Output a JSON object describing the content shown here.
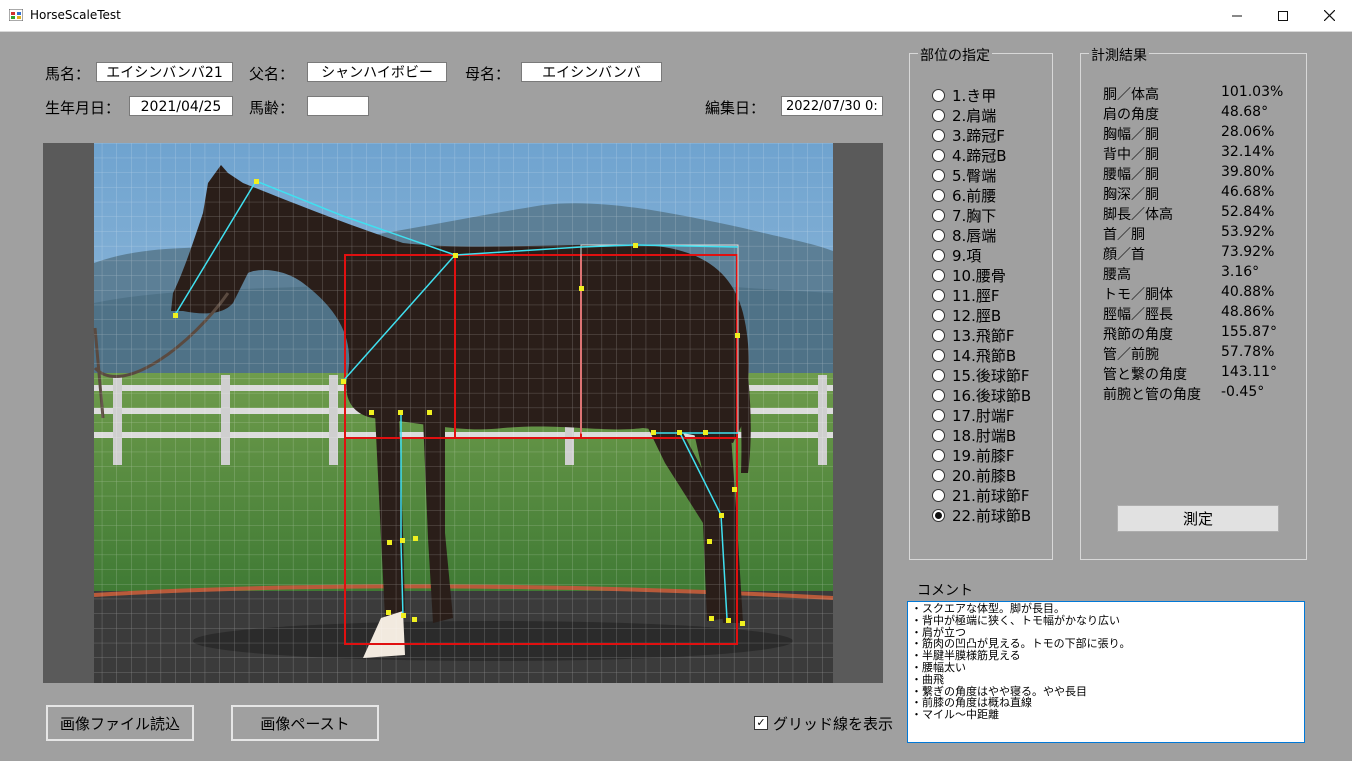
{
  "window": {
    "title": "HorseScaleTest"
  },
  "form": {
    "horse_name_label": "馬名：",
    "horse_name": "エイシンバンバ21",
    "sire_label": "父名：",
    "sire": "シャンハイボビー",
    "dam_label": "母名：",
    "dam": "エイシンバンバ",
    "birth_label": "生年月日：",
    "birth": "2021/04/25",
    "age_label": "馬齢：",
    "age": "",
    "edit_label": "編集日：",
    "edit_date": "2022/07/30 0:"
  },
  "parts": {
    "title": "部位の指定",
    "items": [
      "1.き甲",
      "2.肩端",
      "3.蹄冠F",
      "4.蹄冠B",
      "5.臀端",
      "6.前腰",
      "7.胸下",
      "8.唇端",
      "9.項",
      "10.腰骨",
      "11.脛F",
      "12.脛B",
      "13.飛節F",
      "14.飛節B",
      "15.後球節F",
      "16.後球節B",
      "17.肘端F",
      "18.肘端B",
      "19.前膝F",
      "20.前膝B",
      "21.前球節F",
      "22.前球節B"
    ],
    "selected_index": 21
  },
  "results": {
    "title": "計測結果",
    "rows": [
      {
        "name": "胴／体高",
        "value": "101.03%"
      },
      {
        "name": "肩の角度",
        "value": "48.68°"
      },
      {
        "name": "胸幅／胴",
        "value": "28.06%"
      },
      {
        "name": "背中／胴",
        "value": "32.14%"
      },
      {
        "name": "腰幅／胴",
        "value": "39.80%"
      },
      {
        "name": "胸深／胴",
        "value": "46.68%"
      },
      {
        "name": "脚長／体高",
        "value": "52.84%"
      },
      {
        "name": "首／胴",
        "value": "53.92%"
      },
      {
        "name": "顔／首",
        "value": "73.92%"
      },
      {
        "name": "腰高",
        "value": "3.16°"
      },
      {
        "name": "トモ／胴体",
        "value": "40.88%"
      },
      {
        "name": "脛幅／脛長",
        "value": "48.86%"
      },
      {
        "name": "飛節の角度",
        "value": "155.87°"
      },
      {
        "name": "管／前腕",
        "value": "57.78%"
      },
      {
        "name": "管と繋の角度",
        "value": "143.11°"
      },
      {
        "name": "前腕と管の角度",
        "value": "-0.45°"
      }
    ],
    "measure_button": "測定"
  },
  "comment": {
    "label": "コメント",
    "lines": [
      "・スクエアな体型。脚が長目。",
      "・背中が極端に狭く、トモ幅がかなり広い",
      "・肩が立つ",
      "・筋肉の凹凸が見える。トモの下部に張り。",
      "・半腱半膜様筋見える",
      "・腰幅太い",
      "・曲飛",
      "・繋ぎの角度はやや寝る。やや長目",
      "・前膝の角度は概ね直線",
      "・マイル～中距離"
    ]
  },
  "buttons": {
    "load_image": "画像ファイル読込",
    "paste_image": "画像ペースト"
  },
  "grid_toggle": {
    "label": "グリッド線を表示",
    "checked": true
  },
  "colors": {
    "form_bg": "#a0a0a0",
    "accent": "#0078d7",
    "box_red": "#e01010",
    "line_cyan": "#40e0f0",
    "marker_yellow": "#f0f020"
  }
}
